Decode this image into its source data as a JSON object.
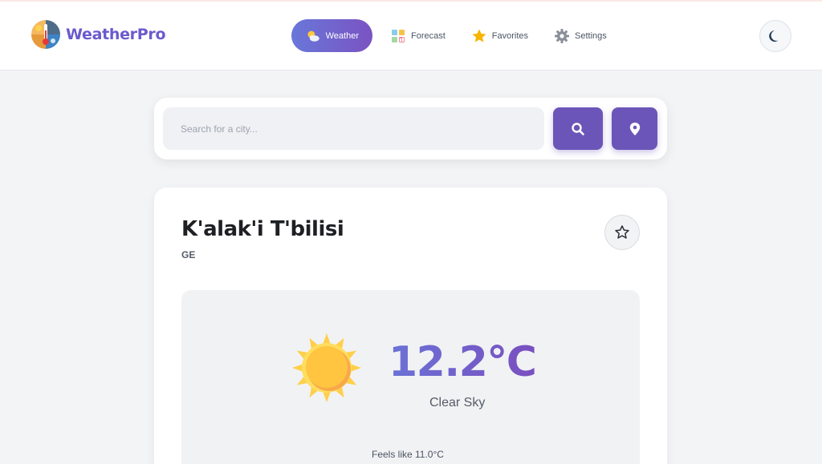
{
  "brand": {
    "name": "WeatherPro",
    "logo_icon": "weather-logo-icon"
  },
  "nav": {
    "items": [
      {
        "label": "Weather",
        "icon": "sun-cloud-icon",
        "active": true
      },
      {
        "label": "Forecast",
        "icon": "calendar-chart-icon",
        "active": false
      },
      {
        "label": "Favorites",
        "icon": "star-icon",
        "active": false
      },
      {
        "label": "Settings",
        "icon": "gear-icon",
        "active": false
      }
    ]
  },
  "theme_toggle": {
    "icon": "moon-icon"
  },
  "search": {
    "placeholder": "Search for a city...",
    "value": "",
    "search_icon": "search-icon",
    "location_icon": "location-pin-icon"
  },
  "weather": {
    "city": "K'alak'i T'bilisi",
    "country": "GE",
    "temperature": "12.2°C",
    "condition": "Clear Sky",
    "condition_icon": "sun-icon",
    "feels_like": "Feels like 11.0°C",
    "favorite_icon": "star-outline-icon"
  },
  "colors": {
    "accent": "#6c55b8",
    "gradient_start": "#6a72d6",
    "gradient_end": "#7a4fbf",
    "background": "#f3f4f6"
  }
}
